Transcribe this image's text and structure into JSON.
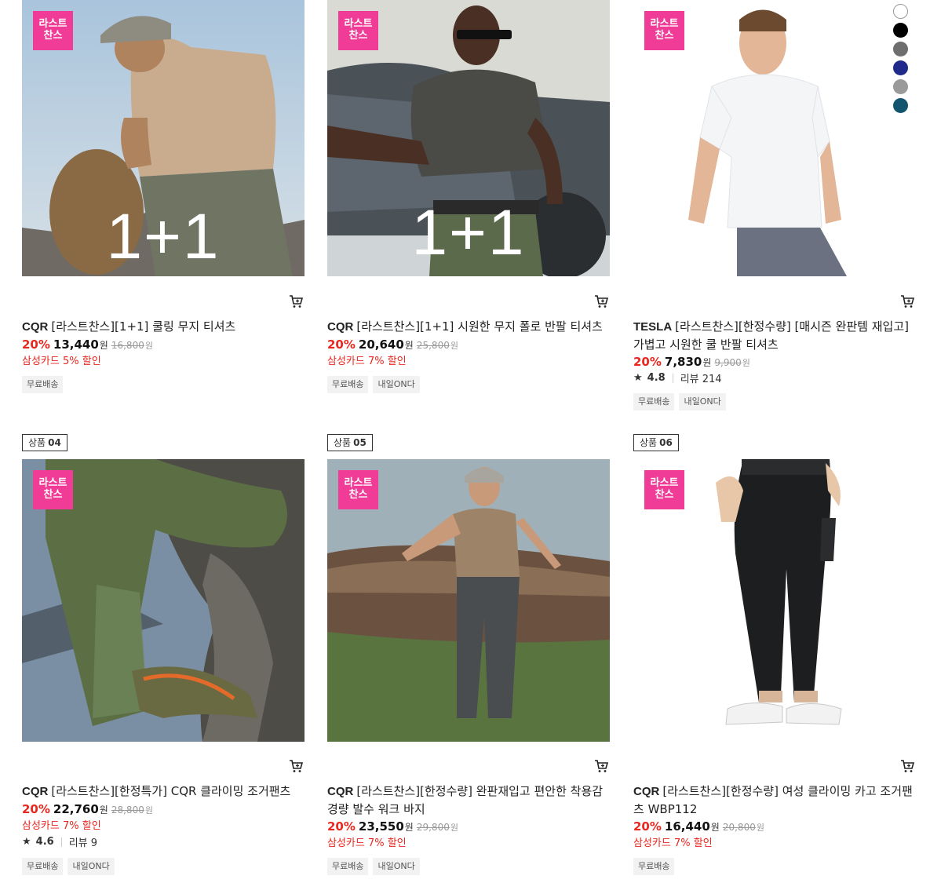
{
  "products": [
    {
      "badge": "라스트\n찬스",
      "overlay": "1+1",
      "brand": "CQR",
      "name": "[라스트찬스][1+1] 쿨링 무지 티셔츠",
      "discount": "20%",
      "price": "13,440",
      "currency": "원",
      "original_price": "16,800",
      "card_promo": "삼성카드 5% 할인",
      "tags": [
        "무료배송"
      ]
    },
    {
      "badge": "라스트\n찬스",
      "overlay": "1+1",
      "brand": "CQR",
      "name": "[라스트찬스][1+1] 시원한 무지 폴로 반팔 티셔츠",
      "discount": "20%",
      "price": "20,640",
      "currency": "원",
      "original_price": "25,800",
      "card_promo": "삼성카드 7% 할인",
      "tags": [
        "무료배송",
        "내일ON다"
      ]
    },
    {
      "badge": "라스트\n찬스",
      "brand": "TESLA",
      "name": "[라스트찬스][한정수량] [매시즌 완판템 재입고] 가볍고 시원한 쿨 반팔 티셔츠",
      "discount": "20%",
      "price": "7,830",
      "currency": "원",
      "original_price": "9,900",
      "rating": "4.8",
      "review_label": "리뷰 214",
      "tags": [
        "무료배송",
        "내일ON다"
      ],
      "swatches": [
        "#ffffff",
        "#000000",
        "#6e6e6e",
        "#1f2a8a",
        "#9a9a9a",
        "#13556e"
      ]
    },
    {
      "rank_label": "상품",
      "rank_num": "04",
      "badge": "라스트\n찬스",
      "brand": "CQR",
      "name": "[라스트찬스][한정특가] CQR 클라이밍 조거팬츠",
      "discount": "20%",
      "price": "22,760",
      "currency": "원",
      "original_price": "28,800",
      "card_promo": "삼성카드 7% 할인",
      "rating": "4.6",
      "review_label": "리뷰 9",
      "tags": [
        "무료배송",
        "내일ON다"
      ]
    },
    {
      "rank_label": "상품",
      "rank_num": "05",
      "badge": "라스트\n찬스",
      "brand": "CQR",
      "name": "[라스트찬스][한정수량] 완판재입고 편안한 착용감 경량 발수 워크 바지",
      "discount": "20%",
      "price": "23,550",
      "currency": "원",
      "original_price": "29,800",
      "card_promo": "삼성카드 7% 할인",
      "tags": [
        "무료배송",
        "내일ON다"
      ]
    },
    {
      "rank_label": "상품",
      "rank_num": "06",
      "badge": "라스트\n찬스",
      "brand": "CQR",
      "name": "[라스트찬스][한정수량] 여성 클라이밍 카고 조거팬츠 WBP112",
      "discount": "20%",
      "price": "16,440",
      "currency": "원",
      "original_price": "20,800",
      "card_promo": "삼성카드 7% 할인",
      "tags": [
        "무료배송"
      ]
    }
  ],
  "icons": {
    "cart": "cart-icon",
    "star": "star-icon"
  },
  "colors": {
    "badge": "#f03c96",
    "discount": "#e8271f"
  }
}
